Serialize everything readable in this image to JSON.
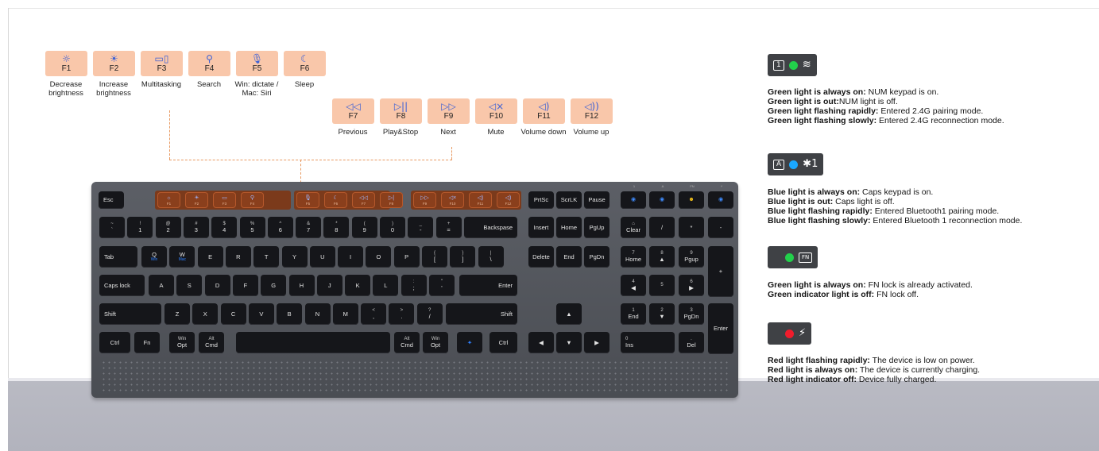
{
  "fkeys_top": [
    {
      "icon": "☼",
      "name": "F1",
      "desc": "Decrease brightness"
    },
    {
      "icon": "☀",
      "name": "F2",
      "desc": "Increase brightness"
    },
    {
      "icon": "▭▯",
      "name": "F3",
      "desc": "Multitasking"
    },
    {
      "icon": "⚲",
      "name": "F4",
      "desc": "Search"
    },
    {
      "icon": "🎙",
      "name": "F5",
      "desc": "Win: dictate / Mac: Siri"
    },
    {
      "icon": "☾",
      "name": "F6",
      "desc": "Sleep"
    }
  ],
  "fkeys_bottom": [
    {
      "icon": "◁◁",
      "name": "F7",
      "desc": "Previous"
    },
    {
      "icon": "▷||",
      "name": "F8",
      "desc": "Play&Stop"
    },
    {
      "icon": "▷▷",
      "name": "F9",
      "desc": "Next"
    },
    {
      "icon": "◁×",
      "name": "F10",
      "desc": "Mute"
    },
    {
      "icon": "◁)",
      "name": "F11",
      "desc": "Volume down"
    },
    {
      "icon": "◁))",
      "name": "F12",
      "desc": "Volume up"
    }
  ],
  "keyboard": {
    "esc": "Esc",
    "fn_row": [
      {
        "icon": "☼",
        "name": "F1"
      },
      {
        "icon": "☀",
        "name": "F2"
      },
      {
        "icon": "▭",
        "name": "F3"
      },
      {
        "icon": "⚲",
        "name": "F4"
      },
      {
        "icon": "🎙",
        "name": "F5"
      },
      {
        "icon": "☾",
        "name": "F6"
      },
      {
        "icon": "◁◁",
        "name": "F7"
      },
      {
        "icon": "▷|",
        "name": "F8"
      },
      {
        "icon": "▷▷",
        "name": "F9"
      },
      {
        "icon": "◁×",
        "name": "F10"
      },
      {
        "icon": "◁)",
        "name": "F11"
      },
      {
        "icon": "◁)",
        "name": "F12"
      }
    ],
    "nav_top": [
      "PrtSc",
      "ScrLK",
      "Pause"
    ],
    "leds": [
      "1",
      "A",
      "FN",
      "⚡"
    ],
    "row1": [
      {
        "t": "~",
        "b": "`"
      },
      {
        "t": "!",
        "b": "1"
      },
      {
        "t": "@",
        "b": "2"
      },
      {
        "t": "#",
        "b": "3"
      },
      {
        "t": "$",
        "b": "4"
      },
      {
        "t": "%",
        "b": "5"
      },
      {
        "t": "^",
        "b": "6"
      },
      {
        "t": "&",
        "b": "7"
      },
      {
        "t": "*",
        "b": "8"
      },
      {
        "t": "(",
        "b": "9"
      },
      {
        "t": ")",
        "b": "0"
      },
      {
        "t": "_",
        "b": "-"
      },
      {
        "t": "+",
        "b": "="
      }
    ],
    "backspace": "Backspase",
    "nav_row1": [
      "Insert",
      "Home",
      "PgUp"
    ],
    "num_row1": [
      {
        "t": "⌂",
        "b": "Clear"
      },
      {
        "t": "",
        "b": "/"
      },
      {
        "t": "",
        "b": "*"
      },
      {
        "t": "",
        "b": "-"
      }
    ],
    "tab": "Tab",
    "row2": [
      {
        "b": "Q",
        "sub": "Win"
      },
      {
        "b": "W",
        "sub": "Mac"
      },
      {
        "b": "E"
      },
      {
        "b": "R"
      },
      {
        "b": "T"
      },
      {
        "b": "Y"
      },
      {
        "b": "U"
      },
      {
        "b": "I"
      },
      {
        "b": "O"
      },
      {
        "b": "P"
      },
      {
        "t": "{",
        "b": "["
      },
      {
        "t": "}",
        "b": "]"
      },
      {
        "t": "|",
        "b": "\\"
      }
    ],
    "nav_row2": [
      "Delete",
      "End",
      "PgDn"
    ],
    "num_row2": [
      {
        "t": "7",
        "b": "Home"
      },
      {
        "t": "8",
        "b": "▲"
      },
      {
        "t": "9",
        "b": "Pgup"
      }
    ],
    "num_plus": "+",
    "caps": "Caps lock",
    "row3": [
      {
        "b": "A"
      },
      {
        "b": "S"
      },
      {
        "b": "D"
      },
      {
        "b": "F"
      },
      {
        "b": "G"
      },
      {
        "b": "H"
      },
      {
        "b": "J"
      },
      {
        "b": "K"
      },
      {
        "b": "L"
      },
      {
        "t": ":",
        "b": ";"
      },
      {
        "t": "\"",
        "b": "'"
      }
    ],
    "enter": "Enter",
    "num_row3": [
      {
        "t": "4",
        "b": "◀"
      },
      {
        "t": "5",
        "b": ""
      },
      {
        "t": "6",
        "b": "▶"
      }
    ],
    "shift": "Shift",
    "row4": [
      {
        "b": "Z"
      },
      {
        "b": "X"
      },
      {
        "b": "C"
      },
      {
        "b": "V"
      },
      {
        "b": "B"
      },
      {
        "b": "N"
      },
      {
        "b": "M"
      },
      {
        "t": "<",
        "b": ","
      },
      {
        "t": ">",
        "b": "."
      },
      {
        "t": "?",
        "b": "/"
      }
    ],
    "arrow_up": "▲",
    "num_row4": [
      {
        "t": "1",
        "b": "End"
      },
      {
        "t": "2",
        "b": "▼"
      },
      {
        "t": "3",
        "b": "PgDn"
      }
    ],
    "num_enter": "Enter",
    "ctrl": "Ctrl",
    "fn": "Fn",
    "winopt": {
      "t": "Win",
      "b": "Opt"
    },
    "altcmd": {
      "t": "Alt",
      "b": "Cmd"
    },
    "logo": "✦",
    "arrows": [
      "◀",
      "▼",
      "▶"
    ],
    "num_0": {
      "t": "0",
      "b": "Ins"
    },
    "num_del": {
      "t": ".",
      "b": "Del"
    }
  },
  "indicators": [
    {
      "icons": [
        "1",
        "wifi"
      ],
      "dot_color": "#22d04b",
      "lines": [
        {
          "bold": "Green light is always on:",
          "text": " NUM keypad is on."
        },
        {
          "bold": "Green light is out:",
          "text": "NUM light is off."
        },
        {
          "bold": "Green light flashing rapidly:",
          "text": " Entered 2.4G pairing mode."
        },
        {
          "bold": "Green light flashing slowly:",
          "text": " Entered 2.4G reconnection mode."
        }
      ]
    },
    {
      "icons": [
        "A",
        "bt1"
      ],
      "dot_color": "#1aa8ff",
      "lines": [
        {
          "bold": "Blue light is always on:",
          "text": " Caps keypad is on."
        },
        {
          "bold": "Blue light is out:",
          "text": " Caps light is off."
        },
        {
          "bold": "Blue light flashing rapidly:",
          "text": " Entered Bluetooth1 pairing mode."
        },
        {
          "bold": "Blue light flashing slowly:",
          "text": " Entered Bluetooth 1 reconnection mode."
        }
      ]
    },
    {
      "icons": [
        "FN"
      ],
      "dot_color": "#22d04b",
      "lines": [
        {
          "bold": "Green light is always on:",
          "text": " FN lock is already activated."
        },
        {
          "bold": "Green indicator light is off:",
          "text": " FN lock off."
        }
      ]
    },
    {
      "icons": [
        "bolt"
      ],
      "dot_color": "#f01c2c",
      "lines": [
        {
          "bold": "Red light flashing rapidly:",
          "text": " The device is low on power."
        },
        {
          "bold": "Red light is always on:",
          "text": " The device is currently charging."
        },
        {
          "bold": "Red light indicator off:",
          "text": " Device fully charged."
        }
      ]
    }
  ]
}
